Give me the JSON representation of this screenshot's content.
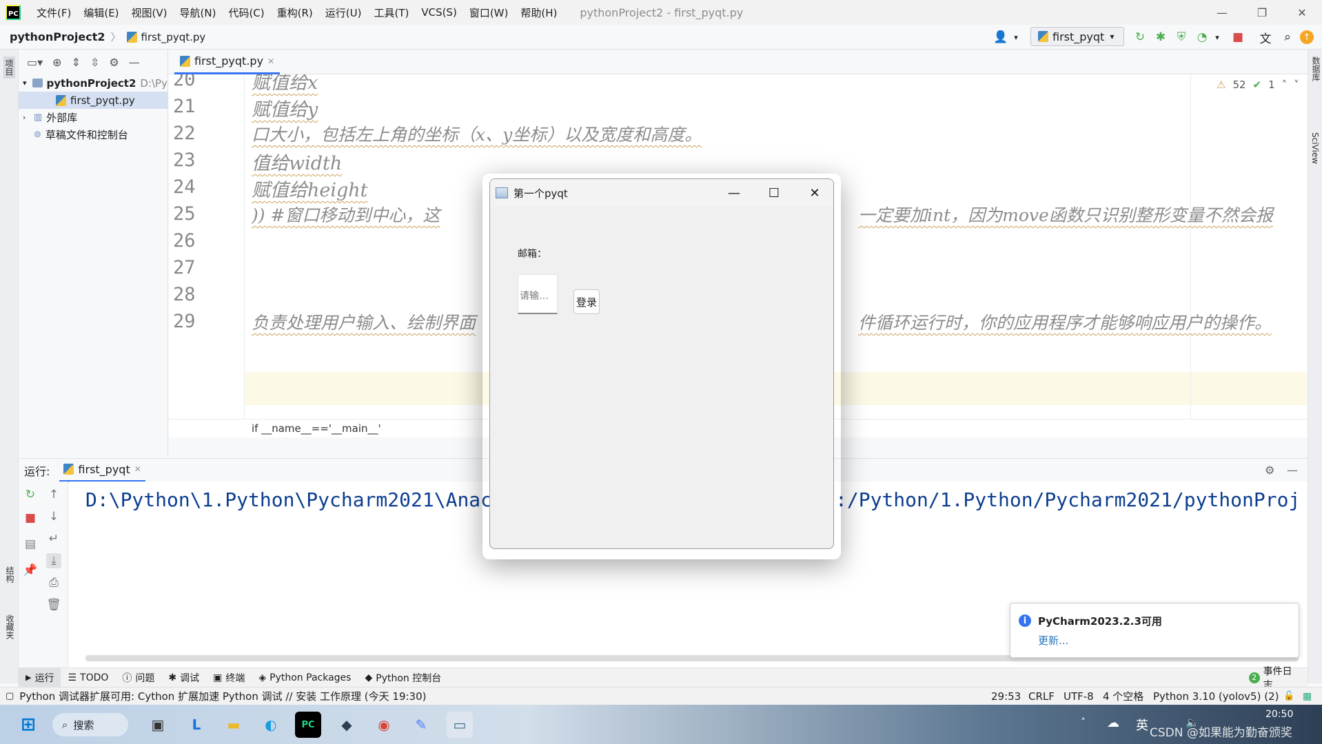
{
  "menubar": {
    "logo_text": "PC",
    "items": [
      "文件(F)",
      "编辑(E)",
      "视图(V)",
      "导航(N)",
      "代码(C)",
      "重构(R)",
      "运行(U)",
      "工具(T)",
      "VCS(S)",
      "窗口(W)",
      "帮助(H)"
    ],
    "window_title": "pythonProject2 - first_pyqt.py"
  },
  "navbar": {
    "project": "pythonProject2",
    "file": "first_pyqt.py",
    "run_config": "first_pyqt"
  },
  "side_strip": {
    "left_top": "项目",
    "left_structure": "结构",
    "left_favorites": "收藏夹",
    "right_database": "数据库",
    "right_sciview": "SciView"
  },
  "project_tree": [
    {
      "label": "pythonProject2",
      "suffix": "D:\\Py",
      "level": 0,
      "expanded": true
    },
    {
      "label": "first_pyqt.py",
      "level": 1,
      "selected": true
    },
    {
      "label": "外部库",
      "level": 0,
      "expanded": false
    },
    {
      "label": "草稿文件和控制台",
      "level": 0
    }
  ],
  "editor": {
    "tab_label": "first_pyqt.py",
    "inspections": {
      "warnings": "52",
      "ok": "1"
    },
    "lines": [
      {
        "num": "20",
        "text": "赋值给x"
      },
      {
        "num": "21",
        "text": "赋值给y"
      },
      {
        "num": "22",
        "text": "口大小，包括左上角的坐标（x、y坐标）以及宽度和高度。"
      },
      {
        "num": "23",
        "text": "值给width"
      },
      {
        "num": "24",
        "text": "赋值给height"
      },
      {
        "num": "25",
        "text_left": "))  #窗口移动到中心，这",
        "text_right": "一定要加int，因为move函数只识别整形变量不然会报"
      },
      {
        "num": "26",
        "text": ""
      },
      {
        "num": "27",
        "text": ""
      },
      {
        "num": "28",
        "text": ""
      },
      {
        "num": "29",
        "text_left": "负责处理用户输入、绘制界面",
        "text_right": "件循环运行时，你的应用程序才能够响应用户的操作。"
      }
    ],
    "breadcrumb": "if __name__=='__main__'"
  },
  "run_panel": {
    "label": "运行:",
    "tab": "first_pyqt",
    "console_left": "D:\\Python\\1.Python\\Pycharm2021\\Anac",
    "console_right": ":/Python/1.Python/Pycharm2021/pythonProj"
  },
  "tool_tabs": [
    {
      "label": "运行",
      "icon": "play-icon"
    },
    {
      "label": "TODO",
      "icon": "list-icon"
    },
    {
      "label": "问题",
      "icon": "info-icon"
    },
    {
      "label": "调试",
      "icon": "bug-icon"
    },
    {
      "label": "终端",
      "icon": "terminal-icon"
    },
    {
      "label": "Python Packages",
      "icon": "layers-icon"
    },
    {
      "label": "Python 控制台",
      "icon": "python-icon"
    }
  ],
  "event_log": {
    "count": "2",
    "label": "事件日志"
  },
  "status_bar": {
    "message": "Python 调试器扩展可用: Cython 扩展加速 Python 调试 // 安装   工作原理 (今天 19:30)",
    "position": "29:53",
    "line_sep": "CRLF",
    "encoding": "UTF-8",
    "indent": "4 个空格",
    "interpreter": "Python 3.10 (yolov5) (2)"
  },
  "notification": {
    "title": "PyCharm2023.2.3可用",
    "link": "更新..."
  },
  "pyqt_window": {
    "title": "第一个pyqt",
    "email_label": "邮箱：",
    "input_placeholder": "请输…",
    "login_button": "登录"
  },
  "taskbar": {
    "search": "搜索",
    "ime": "英",
    "time": "20:50",
    "watermark": "CSDN @如果能为勤奋颁奖"
  },
  "colors": {
    "accent": "#3574f0",
    "code_comment": "#8c8c8c",
    "console_text": "#0b3d91",
    "warning": "#c9a35a",
    "stop_red": "#d94c4c",
    "run_green": "#4caf50"
  }
}
